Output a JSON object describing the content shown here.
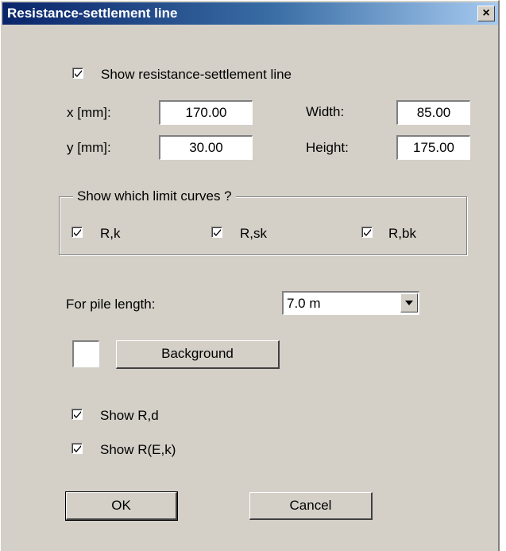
{
  "window": {
    "title": "Resistance-settlement line",
    "close_label": "×"
  },
  "show_line": {
    "label": "Show resistance-settlement line",
    "checked": true
  },
  "fields": {
    "x_label": "x [mm]:",
    "x_value": "170.00",
    "y_label": "y [mm]:",
    "y_value": "30.00",
    "width_label": "Width:",
    "width_value": "85.00",
    "height_label": "Height:",
    "height_value": "175.00"
  },
  "limit_curves": {
    "legend": "Show which limit curves ?",
    "items": [
      {
        "label": "R,k",
        "checked": true
      },
      {
        "label": "R,sk",
        "checked": true
      },
      {
        "label": "R,bk",
        "checked": true
      }
    ]
  },
  "pile_length": {
    "label": "For pile length:",
    "value": "7.0 m"
  },
  "background": {
    "button_label": "Background",
    "swatch_color": "#ffffff"
  },
  "show_rd": {
    "label": "Show R,d",
    "checked": true
  },
  "show_rek": {
    "label": "Show R(E,k)",
    "checked": true
  },
  "buttons": {
    "ok": "OK",
    "cancel": "Cancel"
  }
}
